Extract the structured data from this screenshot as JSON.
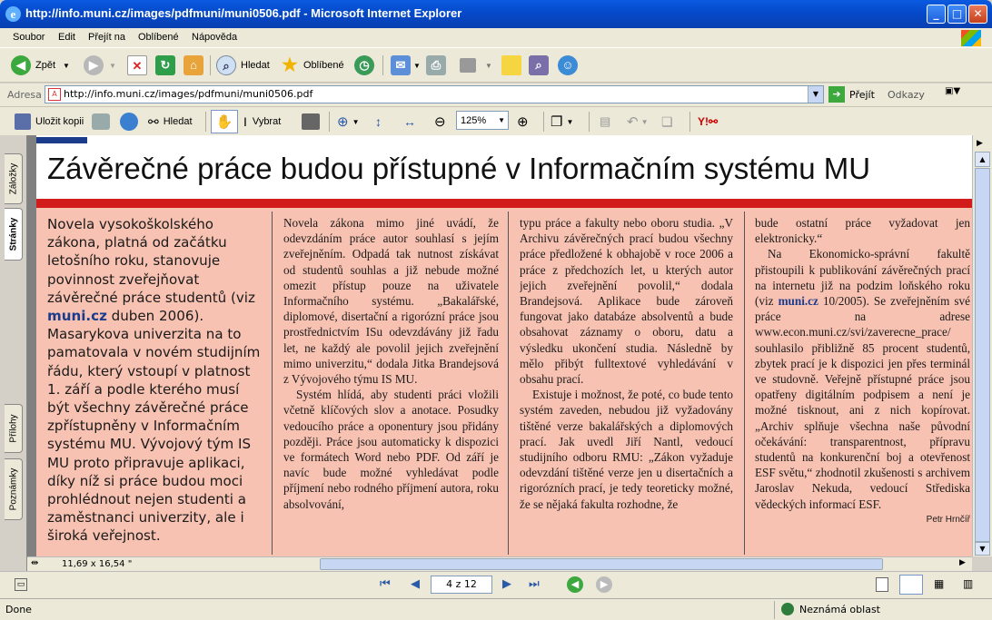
{
  "window": {
    "title": "http://info.muni.cz/images/pdfmuni/muni0506.pdf - Microsoft Internet Explorer"
  },
  "menu": [
    "Soubor",
    "Edit",
    "Přejít na",
    "Oblíbené",
    "Nápověda"
  ],
  "toolbar": {
    "back": "Zpět",
    "search": "Hledat",
    "favorites": "Oblíbené"
  },
  "address": {
    "label": "Adresa",
    "url": "http://info.muni.cz/images/pdfmuni/muni0506.pdf",
    "go": "Přejít",
    "links": "Odkazy"
  },
  "pdf_toolbar": {
    "save_copy": "Uložit kopii",
    "search": "Hledat",
    "select": "Vybrat",
    "zoom": "125%"
  },
  "sidebar": {
    "tab_bookmarks": "Záložky",
    "tab_pages": "Stránky",
    "tab_attachments": "Přílohy",
    "tab_comments": "Poznámky"
  },
  "article": {
    "headline": "Závěrečné práce budou přístupné v Informačním systému MU",
    "lead_a": "Novela vysokoškolského zákona, platná od začátku letošního roku, stanovuje povinnost zveřejňovat závěrečné práce studentů (viz ",
    "lead_link": "muni.cz",
    "lead_b": " duben 2006). Masarykova univerzita na to pamatovala v novém studijním řádu, který vstoupí v platnost 1. září a podle kterého musí být všechny závěrečné práce zpřístupněny v Informačním systému MU. Vývojový tým IS MU proto připravuje aplikaci, díky níž si práce budou moci prohlédnout nejen studenti a zaměstnanci univerzity, ale i široká veřejnost.",
    "c2_p1": "Novela zákona mimo jiné uvádí, že odevzdáním práce autor souhlasí s jejím zveřejněním. Odpadá tak nutnost získávat od studentů souhlas a již nebude možné omezit přístup pouze na uživatele Informačního systému. „Bakalářské, diplomové, disertační a rigorózní práce jsou prostřednictvím ISu odevzdávány již řadu let, ne každý ale povolil jejich zveřejnění mimo univerzitu,“ dodala Jitka Brandejsová z Vývojového týmu IS MU.",
    "c2_p2": "Systém hlídá, aby studenti práci vložili včetně klíčových slov a anotace. Posudky vedoucího práce a oponentury jsou přidány později. Práce jsou automaticky k dispozici ve formátech Word nebo PDF. Od září je navíc bude možné vyhledávat podle příjmení nebo rodného příjmení autora, roku absolvování,",
    "c3_p1": "typu práce a fakulty nebo oboru studia. „V Archivu závěrečných prací budou všechny práce předložené k obhajobě v roce 2006 a práce z předchozích let, u kterých autor jejich zveřejnění povolil,“ dodala Brandejsová. Aplikace bude zároveň fungovat jako databáze absolventů a bude obsahovat záznamy o oboru, datu a výsledku ukončení studia. Následně by mělo přibýt fulltextové vyhledávání v obsahu prací.",
    "c3_p2": "Existuje i možnost, že poté, co bude tento systém zaveden, nebudou již vyžadovány tištěné verze bakalářských a diplomových prací. Jak uvedl Jiří Nantl, vedoucí studijního odboru RMU: „Zákon vyžaduje odevzdání tištěné verze jen u disertačních a rigorózních prací, je tedy teoreticky možné, že se nějaká fakulta rozhodne, že",
    "c4_p1": "bude ostatní práce vyžadovat jen elektronicky.“",
    "c4_p2a": "Na Ekonomicko-správní fakultě přistoupili k publikování závěrečných prací na internetu již na podzim loňského roku (viz ",
    "c4_link": "muni.cz",
    "c4_p2b": " 10/2005). Se zveřejněním své práce na adrese www.econ.muni.cz/svi/zaverecne_prace/ souhlasilo přibližně 85 procent studentů, zbytek prací je k dispozici jen přes terminál ve studovně. Veřejně přístupné práce jsou opatřeny digitálním podpisem a není je možné tisknout, ani z nich kopírovat. „Archiv splňuje všechna naše původní očekávání: transparentnost, přípravu studentů na konkurenční boj a otevřenost ESF světu,“ zhodnotil zkušenosti s archivem Jaroslav Nekuda, vedoucí Střediska vědeckých informací ESF.",
    "author": "Petr Hrnčíř"
  },
  "pdf_status": {
    "page_size": "11,69 x 16,54 \"",
    "page": "4 z 12"
  },
  "ie_status": {
    "left": "Done",
    "zone": "Neznámá oblast"
  }
}
